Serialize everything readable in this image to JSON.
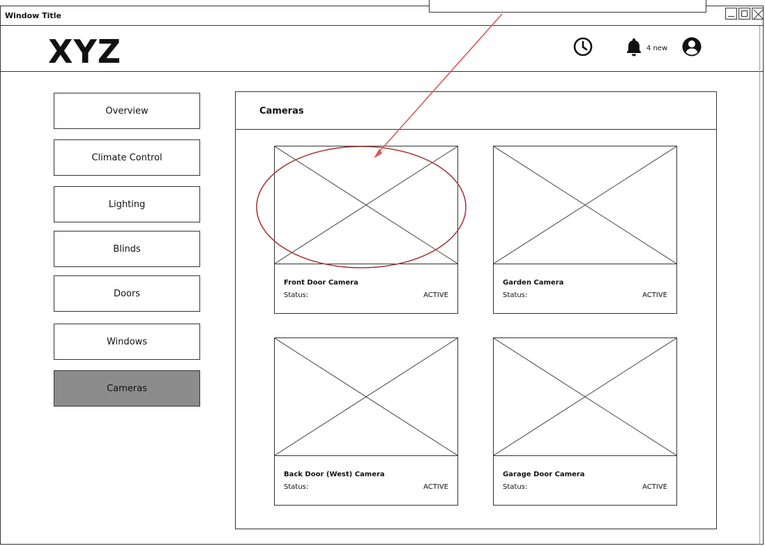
{
  "window": {
    "title": "Window Title"
  },
  "header": {
    "logo": "XYZ",
    "notifications": "4 new"
  },
  "sidebar": {
    "items": [
      {
        "label": "Overview"
      },
      {
        "label": "Climate Control"
      },
      {
        "label": "Lighting"
      },
      {
        "label": "Blinds"
      },
      {
        "label": "Doors"
      },
      {
        "label": "Windows"
      },
      {
        "label": "Cameras",
        "active": true
      }
    ]
  },
  "main": {
    "title": "Cameras",
    "cameras": [
      {
        "name": "Front Door Camera",
        "status_label": "Status:",
        "status": "ACTIVE"
      },
      {
        "name": "Garden Camera",
        "status_label": "Status:",
        "status": "ACTIVE"
      },
      {
        "name": "Back Door (West) Camera",
        "status_label": "Status:",
        "status": "ACTIVE"
      },
      {
        "name": "Garage Door Camera",
        "status_label": "Status:",
        "status": "ACTIVE"
      }
    ]
  },
  "icons": {
    "clock": "clock-icon",
    "bell": "bell-icon",
    "user": "user-avatar-icon",
    "minimize": "minimize-icon",
    "maximize": "maximize-icon",
    "close": "close-icon"
  },
  "colors": {
    "active_nav": "#8c8c8c",
    "annotation_arrow": "#e05555",
    "annotation_circle": "#a83a3a"
  }
}
